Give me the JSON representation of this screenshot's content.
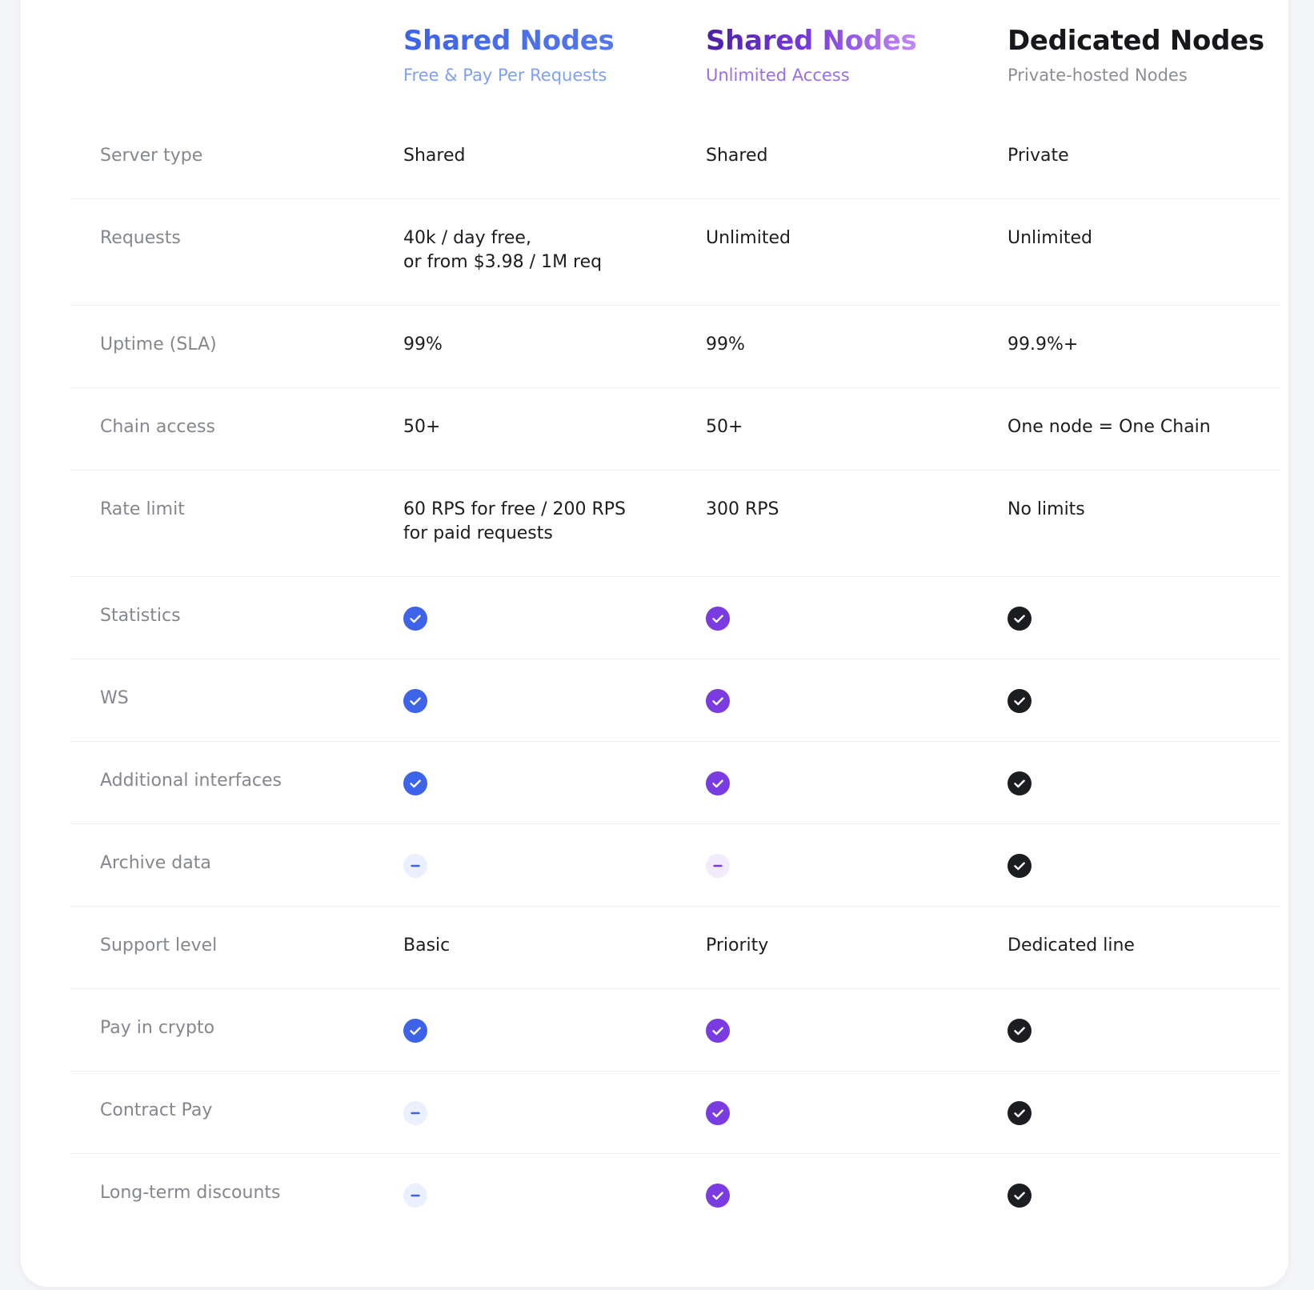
{
  "plans": [
    {
      "title": "Shared Nodes",
      "subtitle": "Free & Pay Per Requests"
    },
    {
      "title": "Shared Nodes",
      "subtitle": "Unlimited Access"
    },
    {
      "title": "Dedicated Nodes",
      "subtitle": "Private-hosted Nodes"
    }
  ],
  "colors": {
    "plan1_accent": "#3d63e8",
    "plan2_accent": "#7a3be0",
    "plan3_accent": "#1c1d21"
  },
  "rows": [
    {
      "label": "Server type",
      "values": [
        [
          "Shared"
        ],
        [
          "Shared"
        ],
        [
          "Private"
        ]
      ]
    },
    {
      "label": "Requests",
      "values": [
        [
          "40k / day free,",
          "or from $3.98 / 1M req"
        ],
        [
          "Unlimited"
        ],
        [
          "Unlimited"
        ]
      ]
    },
    {
      "label": "Uptime (SLA)",
      "values": [
        [
          "99%"
        ],
        [
          "99%"
        ],
        [
          "99.9%+"
        ]
      ]
    },
    {
      "label": "Chain access",
      "values": [
        [
          "50+"
        ],
        [
          "50+"
        ],
        [
          "One node = One Chain"
        ]
      ]
    },
    {
      "label": "Rate limit",
      "values": [
        [
          "60 RPS for free / 200 RPS",
          "for paid requests"
        ],
        [
          "300 RPS"
        ],
        [
          "No limits"
        ]
      ]
    },
    {
      "label": "Statistics",
      "icons": [
        "check-icon",
        "check-icon",
        "check-icon"
      ]
    },
    {
      "label": "WS",
      "icons": [
        "check-icon",
        "check-icon",
        "check-icon"
      ]
    },
    {
      "label": "Additional interfaces",
      "icons": [
        "check-icon",
        "check-icon",
        "check-icon"
      ]
    },
    {
      "label": "Archive data",
      "icons": [
        "minus-icon",
        "minus-icon",
        "check-icon"
      ]
    },
    {
      "label": "Support level",
      "values": [
        [
          "Basic"
        ],
        [
          "Priority"
        ],
        [
          "Dedicated line"
        ]
      ]
    },
    {
      "label": "Pay in crypto",
      "icons": [
        "check-icon",
        "check-icon",
        "check-icon"
      ]
    },
    {
      "label": "Contract Pay",
      "icons": [
        "minus-icon",
        "check-icon",
        "check-icon"
      ]
    },
    {
      "label": "Long-term discounts",
      "icons": [
        "minus-icon",
        "check-icon",
        "check-icon"
      ]
    }
  ]
}
